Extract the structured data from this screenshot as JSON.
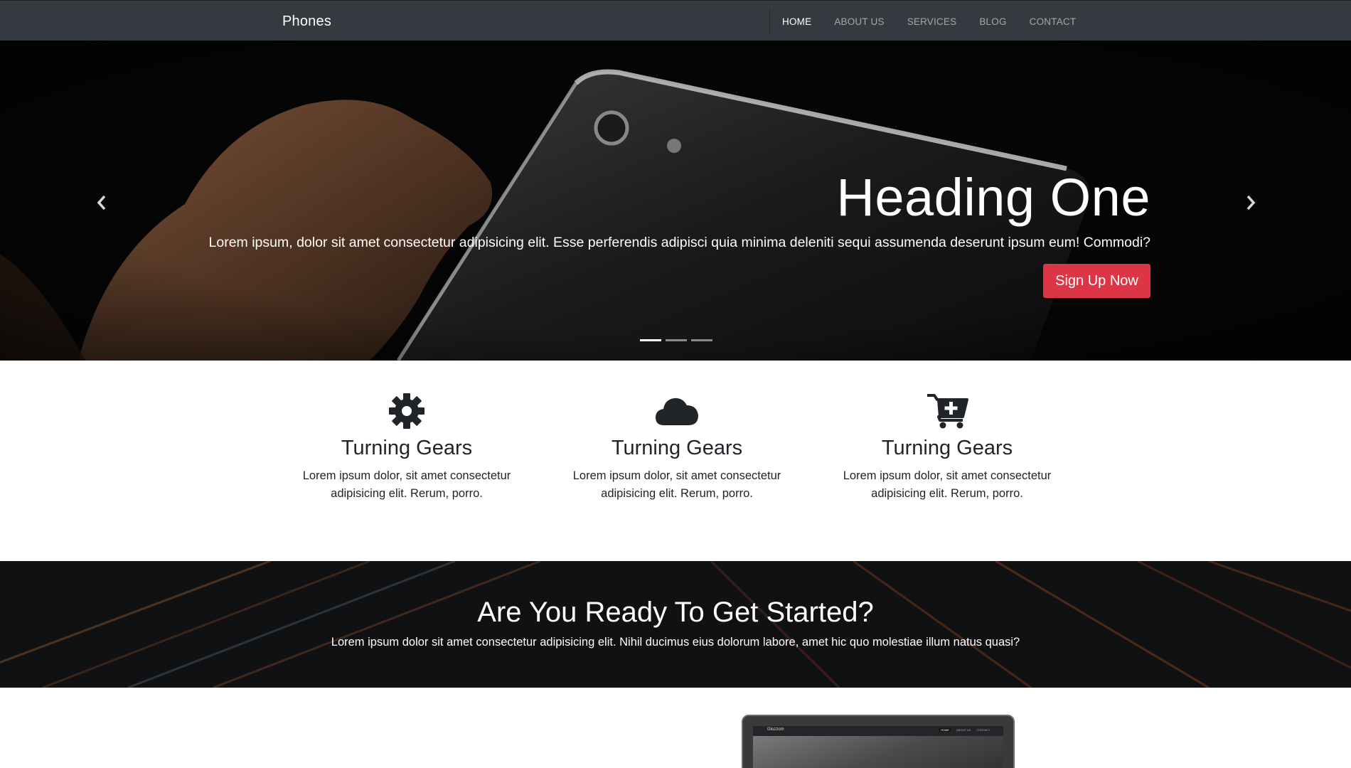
{
  "navbar": {
    "brand": "Phones",
    "links": [
      {
        "label": "HOME",
        "active": true
      },
      {
        "label": "ABOUT US",
        "active": false
      },
      {
        "label": "SERVICES",
        "active": false
      },
      {
        "label": "BLOG",
        "active": false
      },
      {
        "label": "CONTACT",
        "active": false
      }
    ]
  },
  "hero": {
    "title": "Heading One",
    "text": "Lorem ipsum, dolor sit amet consectetur adipisicing elit. Esse perferendis adipisci quia minima deleniti sequi assumenda deserunt ipsum eum! Commodi?",
    "button_label": "Sign Up Now",
    "button_color": "#dc3545",
    "prev_icon": "chevron-left-icon",
    "next_icon": "chevron-right-icon",
    "slides_count": 3,
    "active_slide": 1
  },
  "features": [
    {
      "icon": "gear-icon",
      "title": "Turning Gears",
      "text_line1": "Lorem ipsum dolor, sit amet consectetur",
      "text_line2": "adipisicing elit. Rerum, porro."
    },
    {
      "icon": "cloud-icon",
      "title": "Turning Gears",
      "text_line1": "Lorem ipsum dolor, sit amet consectetur",
      "text_line2": "adipisicing elit. Rerum, porro."
    },
    {
      "icon": "cart-plus-icon",
      "title": "Turning Gears",
      "text_line1": "Lorem ipsum dolor, sit amet consectetur",
      "text_line2": "adipisicing elit. Rerum, porro."
    }
  ],
  "cta": {
    "title": "Are You Ready To Get Started?",
    "text": "Lorem ipsum dolor sit amet consectetur adipisicing elit. Nihil ducimus eius dolorum labore, amet hic quo molestiae illum natus quasi?"
  },
  "laptop_preview": {
    "brand": "Glozzom",
    "links": [
      "HOME",
      "ABOUT US",
      "CONTACT"
    ]
  },
  "colors": {
    "navbar_bg": "#343a40",
    "accent": "#dc3545",
    "text_dark": "#212529"
  }
}
